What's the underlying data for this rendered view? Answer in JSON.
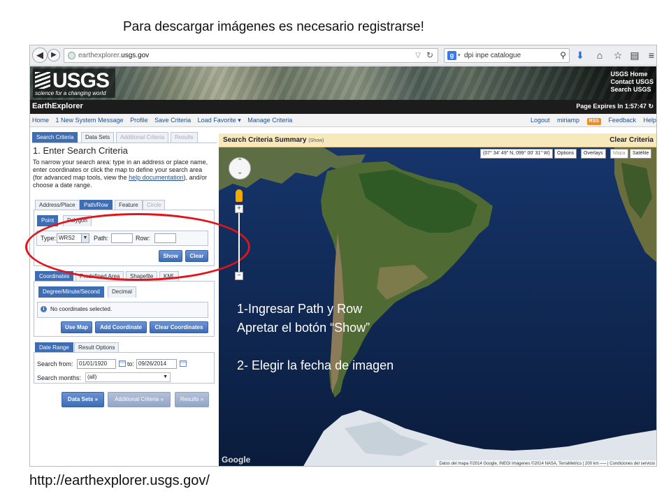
{
  "slide": {
    "title": "Para descargar imágenes es necesario registrarse!",
    "url": "http://earthexplorer.usgs.gov/",
    "notes": {
      "line1": "1-Ingresar Path y Row",
      "line2": "Apretar el botón “Show”",
      "line3": "2- Elegir la fecha de imagen"
    },
    "highlight_color": "#e3131b"
  },
  "browser": {
    "back_icon": "back-arrow-icon",
    "forward_icon": "forward-arrow-icon",
    "address_prefix": "earthexplorer.",
    "address_domain": "usgs.gov",
    "address_icons": [
      "dropdown-icon",
      "refresh-icon"
    ],
    "search_engine_letter": "g",
    "search_text": "dpi inpe catalogue",
    "toolbar_icons": [
      "download-icon",
      "home-icon",
      "star-icon",
      "clipboard-icon",
      "menu-icon"
    ]
  },
  "header": {
    "logo_text": "USGS",
    "logo_tagline": "science for a changing world",
    "links": [
      "USGS Home",
      "Contact USGS",
      "Search USGS"
    ]
  },
  "app_bar": {
    "title": "EarthExplorer",
    "expires": "Page Expires In 1:57:47"
  },
  "menu": {
    "left": [
      "Home",
      "1 New System Message",
      "Profile",
      "Save Criteria",
      "Load Favorite ▾",
      "Manage Criteria"
    ],
    "right": [
      "Logout",
      "miriamp",
      "RSS",
      "Feedback",
      "Help"
    ]
  },
  "tabs": [
    "Search Criteria",
    "Data Sets",
    "Additional Criteria",
    "Results"
  ],
  "criteria": {
    "heading": "1. Enter Search Criteria",
    "help_text_a": "To narrow your search area: type in an address or place name, enter coordinates or click the map to define your search area (for advanced map tools, view the ",
    "help_link": "help documentation",
    "help_text_b": "), and/or choose a date range."
  },
  "location_tabs": [
    "Address/Place",
    "Path/Row",
    "Feature",
    "Circle"
  ],
  "mode_tabs": [
    "Point",
    "Polygon"
  ],
  "path_row": {
    "type_label": "Type:",
    "type_value": "WRS2",
    "path_label": "Path:",
    "path_value": "",
    "row_label": "Row:",
    "row_value": "",
    "show_button": "Show",
    "clear_button": "Clear"
  },
  "coordinate_tabs": [
    "Coordinates",
    "Predefined Area",
    "Shapefile",
    "KML"
  ],
  "coordinate_mode_tabs": [
    "Degree/Minute/Second",
    "Decimal"
  ],
  "coordinates": {
    "message": "No coordinates selected.",
    "buttons": [
      "Use Map",
      "Add Coordinate",
      "Clear Coordinates"
    ]
  },
  "date_tabs": [
    "Date Range",
    "Result Options"
  ],
  "date": {
    "from_label": "Search from:",
    "from_value": "01/01/1920",
    "to_label": "to:",
    "to_value": "09/26/2014",
    "months_label": "Search months:",
    "months_value": "(all)"
  },
  "footer_buttons": [
    "Data Sets »",
    "Additional Criteria »",
    "Results »"
  ],
  "map": {
    "summary_title": "Search Criteria Summary",
    "summary_show": "(Show)",
    "clear": "Clear Criteria",
    "coord_readout": "(07° 34' 49\" N, 099° 00' 31\" W)",
    "controls": [
      "Options",
      "Overlays",
      "Mapa",
      "Satélite"
    ],
    "google": "Google",
    "attribution": "Datos del mapa ©2014 Google, INEGI Imágenes ©2014 NASA, TerraMetrics | 200 km ⎯⎯⎯ | Condiciones del servicio"
  },
  "colors": {
    "accent": "#3e6db4",
    "app_bar": "#1c1c1c",
    "summary_bar": "#f8e9bd",
    "ocean": "#0c2249"
  }
}
